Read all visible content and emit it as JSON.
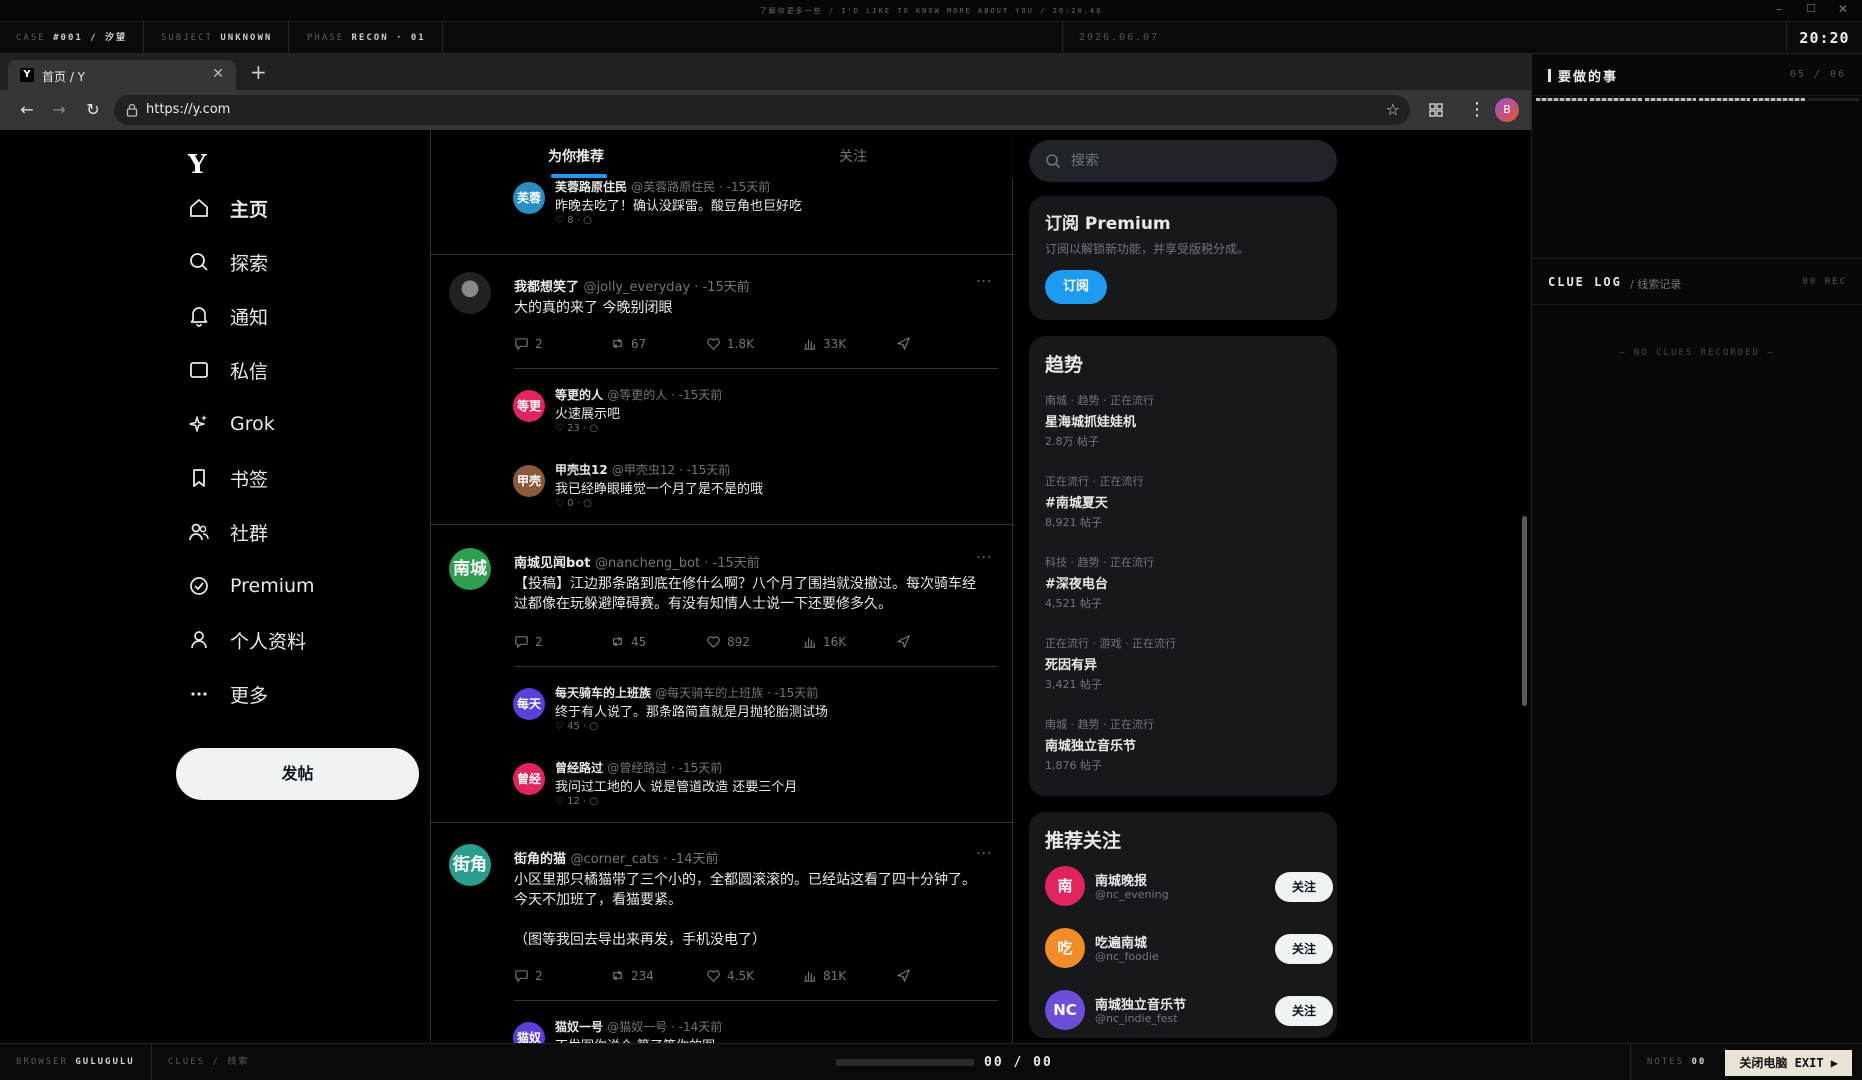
{
  "os": {
    "title": "了解你更多一些 / I'D LIKE TO KNOW MORE ABOUT YOU / 20:20:48"
  },
  "hud": {
    "case_label": "CASE",
    "case_value": "#001 / 汐望",
    "subject_label": "SUBJECT",
    "subject_value": "UNKNOWN",
    "phase_label": "PHASE",
    "phase_value": "RECON · 01",
    "date": "2026.06.07",
    "clock": "20:20"
  },
  "bottom": {
    "browser_label": "BROWSER",
    "browser_value": "GULUGULU",
    "clues_label": "CLUES / 线索",
    "progress": "00 / 00",
    "progress_fraction": 0,
    "notes_label": "NOTES",
    "notes_value": "00",
    "exit_label": "关闭电脑  EXIT ▶"
  },
  "panel": {
    "todo_title": "要做的事",
    "todo_count": "05 / 06",
    "todo_done": 5,
    "todo_total": 6,
    "clue_title": "CLUE LOG",
    "clue_sub": "/ 线索记录",
    "clue_count": "00 REC",
    "clue_empty": "— NO CLUES RECORDED —"
  },
  "browser": {
    "tab_title": "首页 / Y",
    "tab_favicon": "Y",
    "url": "https://y.com",
    "profile_initial": "B"
  },
  "site": {
    "logo": "Y",
    "nav": [
      {
        "label": "主页",
        "icon": "home-icon"
      },
      {
        "label": "探索",
        "icon": "search-icon"
      },
      {
        "label": "通知",
        "icon": "bell-icon"
      },
      {
        "label": "私信",
        "icon": "mail-icon"
      },
      {
        "label": "Grok",
        "icon": "sparkle-icon"
      },
      {
        "label": "书签",
        "icon": "bookmark-icon"
      },
      {
        "label": "社群",
        "icon": "people-icon"
      },
      {
        "label": "Premium",
        "icon": "verified-icon"
      },
      {
        "label": "个人资料",
        "icon": "person-icon"
      },
      {
        "label": "更多",
        "icon": "more-icon"
      }
    ],
    "post_button": "发帖"
  },
  "feed": {
    "tabs": [
      "为你推荐",
      "关注"
    ],
    "top_reply": {
      "avatar": "芙蓉",
      "name": "芙蓉路原住民",
      "meta": "@芙蓉路原住民 · -15天前",
      "text": "昨晚去吃了！确认没踩雷。酸豆角也巨好吃",
      "likes": "8"
    },
    "posts": [
      {
        "avatar": "",
        "avatar_color": "#3a3a3a",
        "name": "我都想笑了",
        "meta": "@jolly_everyday · -15天前",
        "text": "大的真的来了 今晚别闭眼",
        "replies": "2",
        "reposts": "67",
        "likes": "1.8K",
        "views": "33K",
        "sub_replies": [
          {
            "avatar": "等更",
            "color": "#e0245e",
            "name": "等更的人",
            "meta": "@等更的人 · -15天前",
            "text": "火速展示吧",
            "likes": "23"
          },
          {
            "avatar": "甲壳",
            "color": "#8b5a3c",
            "name": "甲壳虫12",
            "meta": "@甲壳虫12 · -15天前",
            "text": "我已经睁眼睡觉一个月了是不是的哦",
            "likes": "0"
          }
        ]
      },
      {
        "avatar": "南城",
        "avatar_color": "#2e9e4f",
        "name": "南城见闻bot",
        "meta": "@nancheng_bot · -15天前",
        "text": "【投稿】江边那条路到底在修什么啊？八个月了围挡就没撤过。每次骑车经\n过都像在玩躲避障碍赛。有没有知情人士说一下还要修多久。",
        "replies": "2",
        "reposts": "45",
        "likes": "892",
        "views": "16K",
        "sub_replies": [
          {
            "avatar": "每天",
            "color": "#5b3fd6",
            "name": "每天骑车的上班族",
            "meta": "@每天骑车的上班族 · -15天前",
            "text": "终于有人说了。那条路简直就是月抛轮胎测试场",
            "likes": "45"
          },
          {
            "avatar": "曾经",
            "color": "#e0245e",
            "name": "曾经路过",
            "meta": "@曾经路过 · -15天前",
            "text": "我问过工地的人 说是管道改造 还要三个月",
            "likes": "12"
          }
        ]
      },
      {
        "avatar": "街角",
        "avatar_color": "#2a9d8f",
        "name": "街角的猫",
        "meta": "@corner_cats · -14天前",
        "text": "小区里那只橘猫带了三个小的，全都圆滚滚的。已经站这看了四十分钟了。\n今天不加班了，看猫要紧。\n\n（图等我回去导出来再发，手机没电了）",
        "replies": "2",
        "reposts": "234",
        "likes": "4.5K",
        "views": "81K",
        "sub_replies": [
          {
            "avatar": "猫奴",
            "color": "#5b3fd6",
            "name": "猫奴一号",
            "meta": "@猫奴一号 · -14天前",
            "text": "不发图你说个 算了等你的图",
            "likes": ""
          }
        ]
      }
    ]
  },
  "sidebar": {
    "search_placeholder": "搜索",
    "premium_title": "订阅 Premium",
    "premium_desc": "订阅以解锁新功能，并享受版税分成。",
    "premium_button": "订阅",
    "trends_title": "趋势",
    "trends": [
      {
        "cat": "南城 · 趋势 · 正在流行",
        "name": "星海城抓娃娃机",
        "count": "2.8万 帖子"
      },
      {
        "cat": "正在流行 · 正在流行",
        "name": "#南城夏天",
        "count": "8,921 帖子"
      },
      {
        "cat": "科技 · 趋势 · 正在流行",
        "name": "#深夜电台",
        "count": "4,521 帖子"
      },
      {
        "cat": "正在流行 · 游戏 · 正在流行",
        "name": "死因有异",
        "count": "3,421 帖子"
      },
      {
        "cat": "南城 · 趋势 · 正在流行",
        "name": "南城独立音乐节",
        "count": "1,876 帖子"
      }
    ],
    "wtf_title": "推荐关注",
    "follow_label": "关注",
    "wtf": [
      {
        "avatar": "南",
        "color": "#e0245e",
        "name": "南城晚报",
        "handle": "@nc_evening"
      },
      {
        "avatar": "吃",
        "color": "#f28c28",
        "name": "吃遍南城",
        "handle": "@nc_foodie"
      },
      {
        "avatar": "NC",
        "color": "#6b4fd8",
        "name": "南城独立音乐节",
        "handle": "@nc_indie_fest"
      }
    ]
  }
}
